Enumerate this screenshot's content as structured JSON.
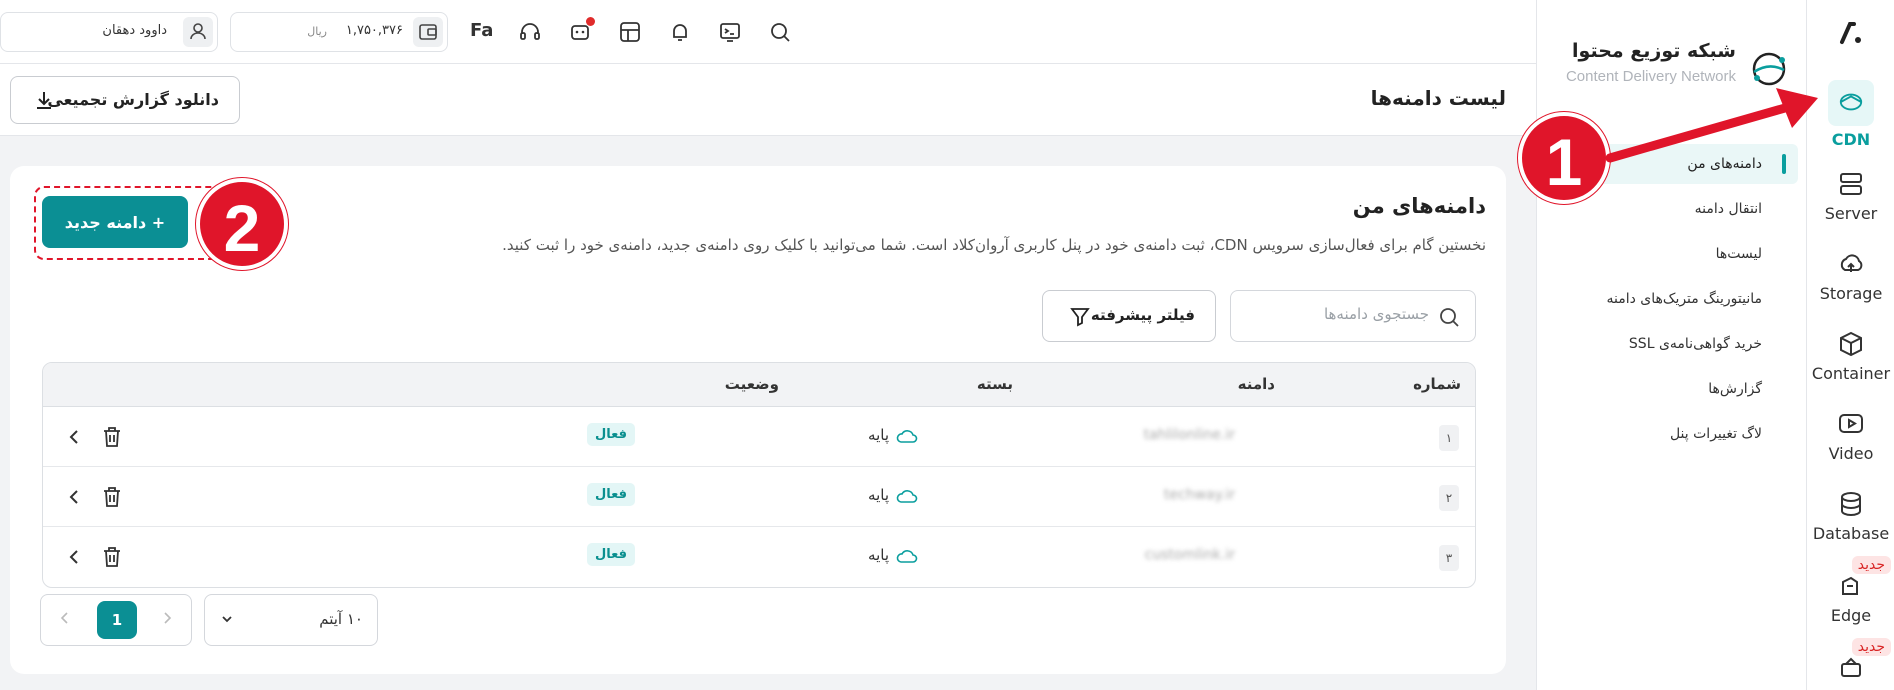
{
  "rail": {
    "items": [
      {
        "label": "CDN",
        "icon": "cdn-icon",
        "active": true
      },
      {
        "label": "Server",
        "icon": "server-icon"
      },
      {
        "label": "Storage",
        "icon": "storage-icon"
      },
      {
        "label": "Container",
        "icon": "container-icon"
      },
      {
        "label": "Video",
        "icon": "video-icon"
      },
      {
        "label": "Database",
        "icon": "database-icon"
      },
      {
        "label": "Edge",
        "icon": "edge-icon",
        "badge": "جدید"
      },
      {
        "label": "",
        "icon": "box-icon",
        "badge": "جدید"
      }
    ]
  },
  "sidebar": {
    "title": "شبکه توزیع محتوا",
    "subtitle": "Content Delivery Network",
    "items": [
      {
        "label": "دامنه‌های من",
        "active": true
      },
      {
        "label": "انتقال دامنه"
      },
      {
        "label": "لیست‌ها"
      },
      {
        "label": "مانیتورینگ متریک‌های دامنه"
      },
      {
        "label": "خرید گواهی‌نامه‌ی SSL"
      },
      {
        "label": "گزارش‌ها"
      },
      {
        "label": "لاگ تغییرات پنل"
      }
    ]
  },
  "topbar": {
    "user_name": "داوود دهقان",
    "wallet_amount": "۱,۷۵۰,۳۷۶",
    "wallet_currency": "ریال",
    "lang": "Fa"
  },
  "page": {
    "title": "لیست دامنه‌ها",
    "download_label": "دانلود گزارش تجمیعی"
  },
  "card": {
    "title": "دامنه‌های من",
    "description": "نخستین گام برای فعال‌سازی سرویس CDN، ثبت دامنه‌ی خود در پنل کاربری آروان‌کلاد است. شما می‌توانید با کلیک روی دامنه‌ی جدید، دامنه‌ی خود را ثبت کنید.",
    "new_domain_label": "+ دامنه جدید",
    "search_placeholder": "جستجوی دامنه‌ها",
    "filter_label": "فیلتر پیشرفته"
  },
  "table": {
    "headers": {
      "num": "شماره",
      "domain": "دامنه",
      "plan": "بسته",
      "status": "وضعیت"
    },
    "rows": [
      {
        "num": "۱",
        "domain": "tahlilonline.ir",
        "plan": "پایه",
        "status": "فعال"
      },
      {
        "num": "۲",
        "domain": "techway.ir",
        "plan": "پایه",
        "status": "فعال"
      },
      {
        "num": "۳",
        "domain": "customlink.ir",
        "plan": "پایه",
        "status": "فعال"
      }
    ]
  },
  "pagination": {
    "current": "1",
    "page_size": "۱۰ آیتم"
  },
  "annotations": {
    "step1": "1",
    "step2": "2"
  },
  "colors": {
    "brand": "#0b8f94",
    "annotation": "#e0152a"
  }
}
